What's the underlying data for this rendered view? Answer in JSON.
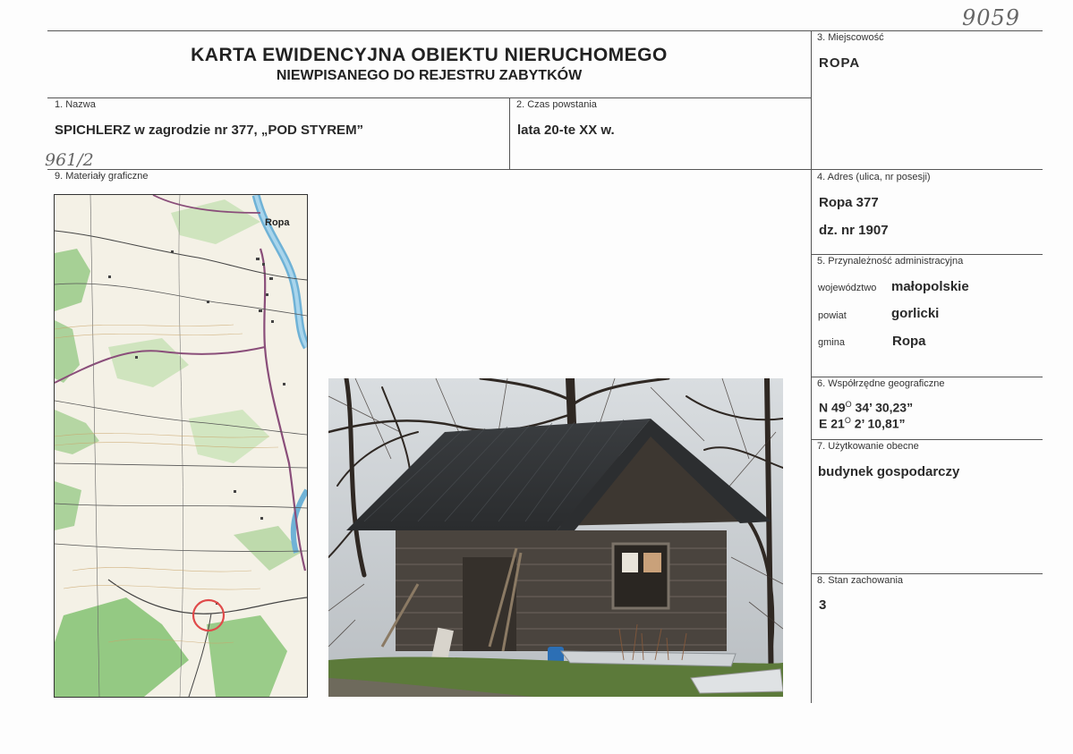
{
  "page": {
    "title": "KARTA EWIDENCYJNA OBIEKTU NIERUCHOMEGO",
    "subtitle": "NIEWPISANEGO DO REJESTRU ZABYTKÓW",
    "handwritten_number": "9059",
    "handwritten_ref": "961/2"
  },
  "fields": {
    "nazwa": {
      "label": "1. Nazwa",
      "value": "SPICHLERZ w zagrodzie nr 377, „POD STYREM”"
    },
    "czas": {
      "label": "2. Czas powstania",
      "value": "lata 20-te XX w."
    },
    "miejscowosc": {
      "label": "3. Miejscowość",
      "value": "ROPA"
    },
    "adres": {
      "label": "4. Adres (ulica, nr posesji)",
      "line1": "Ropa 377",
      "line2": "dz. nr 1907"
    },
    "przynaleznosc": {
      "label": "5. Przynależność administracyjna",
      "wojewodztwo_label": "województwo",
      "wojewodztwo": "małopolskie",
      "powiat_label": "powiat",
      "powiat": "gorlicki",
      "gmina_label": "gmina",
      "gmina": "Ropa"
    },
    "wspolrzedne": {
      "label": "6. Współrzędne geograficzne",
      "n_prefix": "N 49",
      "n_sup": "O",
      "n_rest": " 34’ 30,23”",
      "e_prefix": "E 21",
      "e_sup": "O",
      "e_rest": " 2’ 10,81”"
    },
    "uzytkowanie": {
      "label": "7. Użytkowanie obecne",
      "value": "budynek gospodarczy"
    },
    "stan": {
      "label": "8. Stan zachowania",
      "value": "3"
    },
    "materialy": {
      "label": "9. Materiały graficzne"
    }
  },
  "map": {
    "town_label": "Ropa"
  },
  "colors": {
    "line": "#555555",
    "map_bg": "#f4f1e6",
    "forest": "#7cbf6a",
    "river": "#6fb2d6",
    "marker": "#e04a4a"
  }
}
